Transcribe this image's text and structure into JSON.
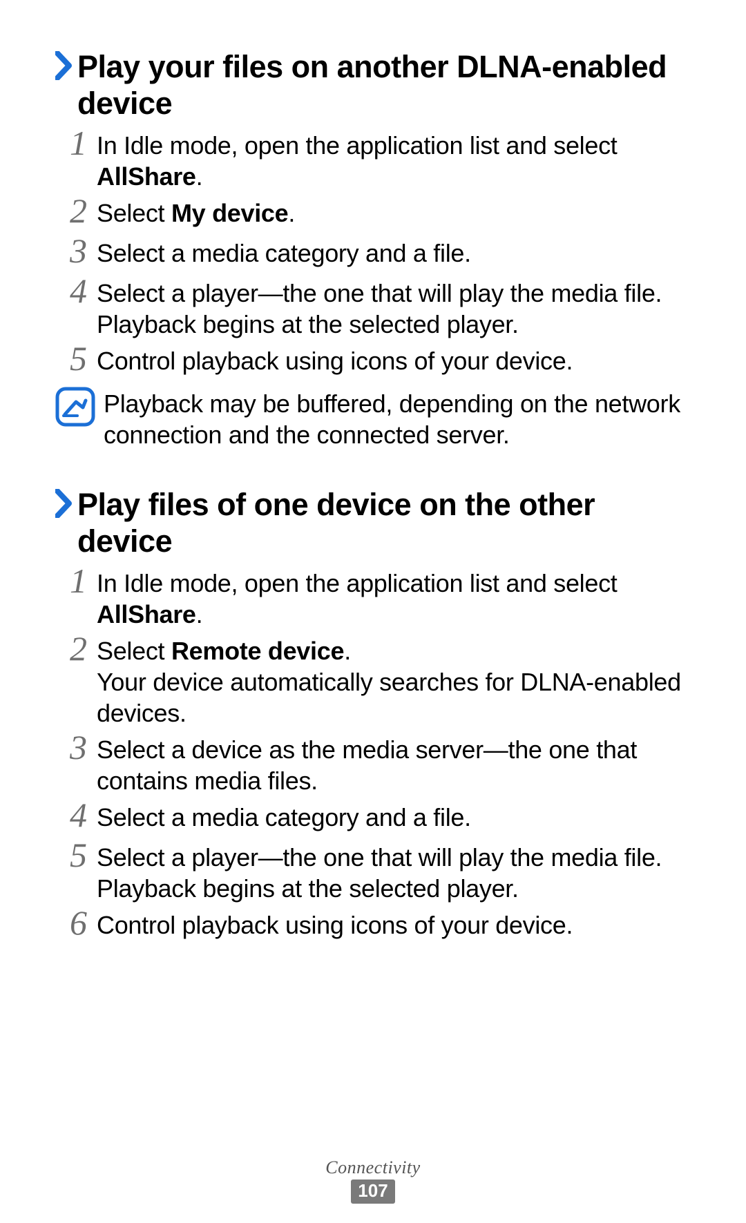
{
  "section1": {
    "heading": "Play your files on another DLNA-enabled device",
    "steps": {
      "s1a": "In Idle mode, open the application list and select ",
      "s1b": "AllShare",
      "s1c": ".",
      "s2a": "Select ",
      "s2b": "My device",
      "s2c": ".",
      "s3": "Select a media category and a file.",
      "s4": "Select a player—the one that will play the media file. Playback begins at the selected player.",
      "s5": "Control playback using icons of your device."
    },
    "note": "Playback may be buffered, depending on the network connection and the connected server."
  },
  "section2": {
    "heading": "Play files of one device on the other device",
    "steps": {
      "s1a": "In Idle mode, open the application list and select ",
      "s1b": "AllShare",
      "s1c": ".",
      "s2a": "Select ",
      "s2b": "Remote device",
      "s2c": ".",
      "s2d": "Your device automatically searches for DLNA-enabled devices.",
      "s3": "Select a device as the media server—the one that contains media files.",
      "s4": "Select a media category and a file.",
      "s5": "Select a player—the one that will play the media file. Playback begins at the selected player.",
      "s6": "Control playback using icons of your device."
    }
  },
  "nums": {
    "n1": "1",
    "n2": "2",
    "n3": "3",
    "n4": "4",
    "n5": "5",
    "n6": "6"
  },
  "footer": {
    "section": "Connectivity",
    "page": "107"
  }
}
